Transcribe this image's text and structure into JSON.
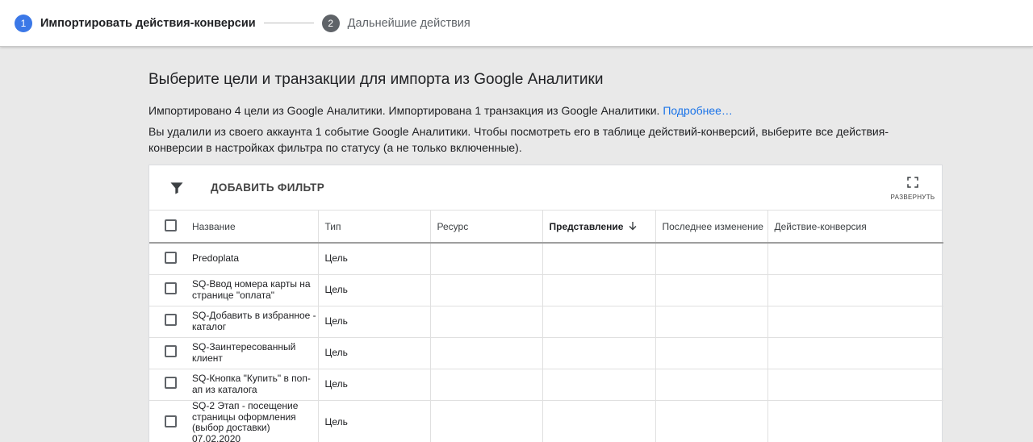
{
  "stepper": {
    "steps": [
      {
        "number": "1",
        "label": "Импортировать действия-конверсии",
        "state": "active"
      },
      {
        "number": "2",
        "label": "Дальнейшие действия",
        "state": "inactive"
      }
    ]
  },
  "main": {
    "title": "Выберите цели и транзакции для импорта из Google Аналитики",
    "info_text": "Импортировано 4 цели из Google Аналитики. Импортирована 1 транзакция из Google Аналитики.",
    "info_link": "Подробнее…",
    "warning_text": "Вы удалили из своего аккаунта 1 событие Google Аналитики. Чтобы посмотреть его в таблице действий-конверсий, выберите все действия-конверсии в настройках фильтра по статусу (а не только включенные)."
  },
  "toolbar": {
    "add_filter_label": "ДОБАВИТЬ ФИЛЬТР",
    "expand_label": "РАЗВЕРНУТЬ"
  },
  "table": {
    "columns": [
      {
        "label": "Название"
      },
      {
        "label": "Тип"
      },
      {
        "label": "Ресурс"
      },
      {
        "label": "Представление",
        "sorted": "desc"
      },
      {
        "label": "Последнее изменение"
      },
      {
        "label": "Действие-конверсия"
      }
    ],
    "rows": [
      {
        "name": "Predoplata",
        "type": "Цель"
      },
      {
        "name": "SQ-Ввод номера карты на странице \"оплата\"",
        "type": "Цель"
      },
      {
        "name": "SQ-Добавить в избранное - каталог",
        "type": "Цель"
      },
      {
        "name": "SQ-Заинтересованный клиент",
        "type": "Цель"
      },
      {
        "name": "SQ-Кнопка \"Купить\" в поп-ап из каталога",
        "type": "Цель"
      },
      {
        "name": "SQ-2 Этап - посещение страницы оформления (выбор доставки) 07.02.2020",
        "type": "Цель"
      }
    ]
  },
  "colors": {
    "accent": "#3b78e7",
    "link": "#1a73e8",
    "background": "#e9e9e9"
  }
}
